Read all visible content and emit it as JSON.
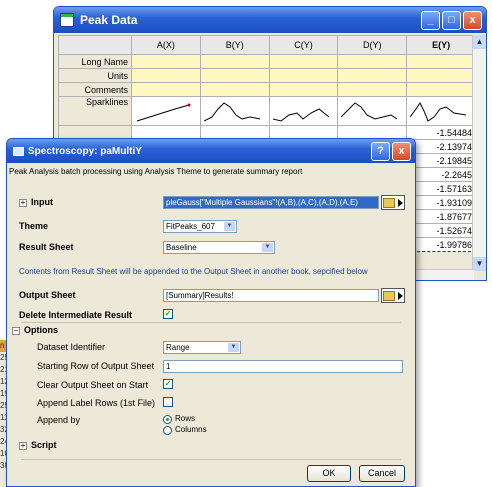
{
  "left_strip": [
    "n",
    "25",
    "21",
    "12",
    "19",
    "25",
    "11",
    "32",
    "24",
    "16",
    "38"
  ],
  "peak_window": {
    "title": "Peak Data",
    "buttons": [
      "_",
      "□",
      "x"
    ],
    "columns": [
      "",
      "A(X)",
      "B(Y)",
      "C(Y)",
      "D(Y)",
      "E(Y)"
    ],
    "row_labels": [
      "Long Name",
      "Units",
      "Comments",
      "Sparklines"
    ],
    "e_values": [
      "-1.54484",
      "-2.13974",
      "-2.19845",
      "-2.2645",
      "-1.57163",
      "-1.93109",
      "-1.87677",
      "-1.52674",
      "-1.99786"
    ]
  },
  "dialog": {
    "title": "Spectroscopy: paMultiY",
    "description": "Peak Analysis batch processing using Analysis Theme to generate summary report",
    "input_label": "Input",
    "input_value": "pleGauss[\"Multiple Gaussians\"!(A,B),(A,C),(A,D),(A,E)",
    "theme_label": "Theme",
    "theme_value": "FitPeaks_607",
    "result_sheet_label": "Result Sheet",
    "result_sheet_value": "Baseline",
    "note": "Contents from Result Sheet will be appended to the Output Sheet in another book, sepcified below",
    "output_sheet_label": "Output Sheet",
    "output_sheet_value": "[Summary]Results!",
    "delete_label": "Delete Intermediate Result",
    "delete_checked": true,
    "options_label": "Options",
    "dataset_identifier_label": "Dataset Identifier",
    "dataset_identifier_value": "Range",
    "starting_row_label": "Starting Row of Output Sheet",
    "starting_row_value": "1",
    "clear_label": "Clear Output Sheet on Start",
    "clear_checked": true,
    "append_label_rows_label": "Append Label Rows (1st File)",
    "append_label_rows_checked": false,
    "append_by_label": "Append by",
    "append_by_options": [
      "Rows",
      "Columns"
    ],
    "append_by_selected": "Rows",
    "script_label": "Script",
    "ok_label": "OK",
    "cancel_label": "Cancel",
    "help_button": "?",
    "close_button": "x"
  }
}
